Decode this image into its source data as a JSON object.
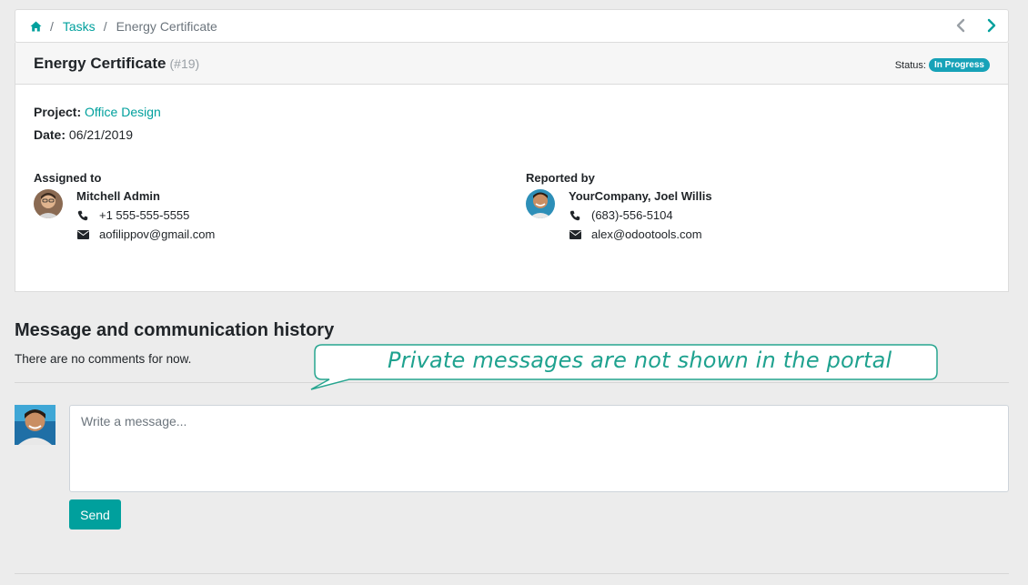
{
  "breadcrumb": {
    "home_icon": "home-icon",
    "tasks_label": "Tasks",
    "current": "Energy Certificate",
    "separator": "/"
  },
  "pager": {
    "prev_icon": "chevron-left-icon",
    "next_icon": "chevron-right-icon"
  },
  "task": {
    "title": "Energy Certificate",
    "number": "(#19)",
    "status_label": "Status:",
    "status_value": "In Progress",
    "project_label": "Project:",
    "project_value": "Office Design",
    "date_label": "Date:",
    "date_value": "06/21/2019"
  },
  "assigned": {
    "heading": "Assigned to",
    "name": "Mitchell Admin",
    "phone": "+1 555-555-5555",
    "email": "aofilippov@gmail.com"
  },
  "reported": {
    "heading": "Reported by",
    "name": "YourCompany, Joel Willis",
    "phone": "(683)-556-5104",
    "email": "alex@odootools.com"
  },
  "messages": {
    "title": "Message and communication history",
    "empty_text": "There are no comments for now.",
    "placeholder": "Write a message...",
    "send_label": "Send"
  },
  "callout": {
    "text": "Private messages are not shown in the portal"
  },
  "colors": {
    "accent": "#00a09d",
    "badge": "#17a2b8",
    "callout_border": "#27a58f"
  }
}
